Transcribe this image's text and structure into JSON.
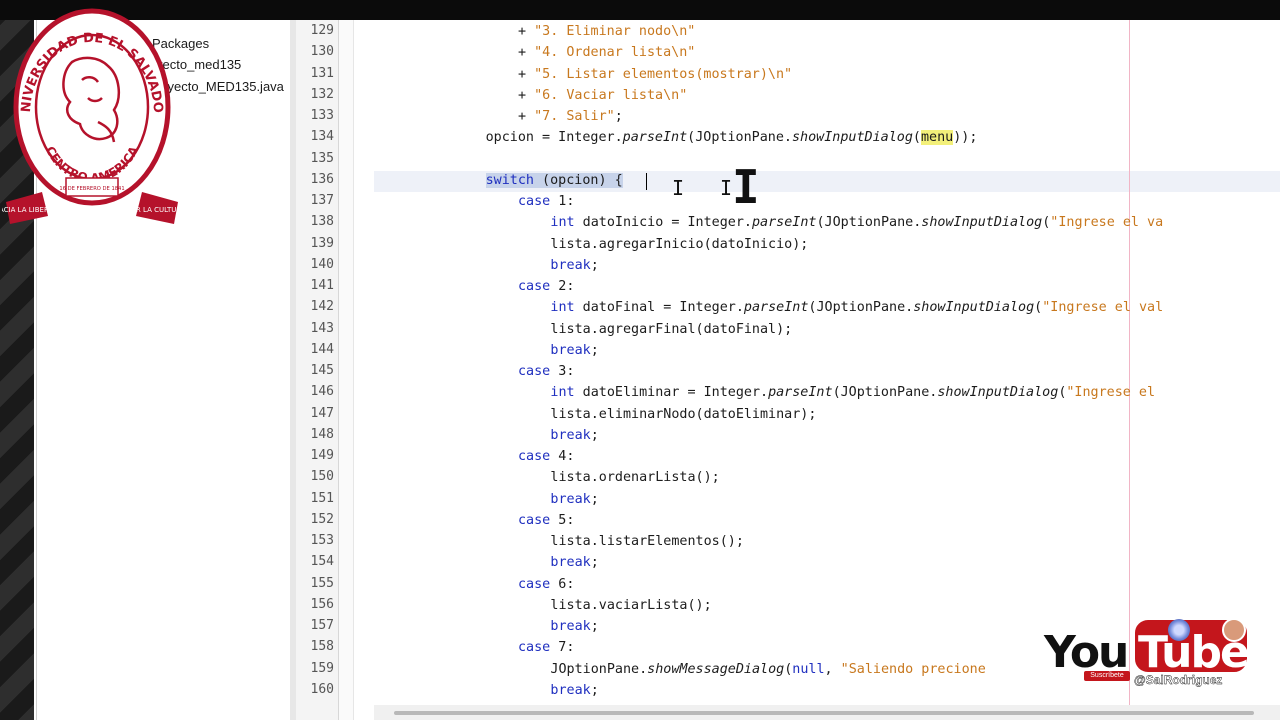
{
  "project_tree": {
    "items": [
      "Packages",
      "yecto_med135",
      "royecto_MED135.java"
    ]
  },
  "editor": {
    "lines": [
      {
        "n": "129",
        "indent": 20,
        "tokens": [
          {
            "t": "+ "
          },
          {
            "t": "\"3. Eliminar nodo\\n\"",
            "c": "str"
          }
        ]
      },
      {
        "n": "130",
        "indent": 20,
        "tokens": [
          {
            "t": "+ "
          },
          {
            "t": "\"4. Ordenar lista\\n\"",
            "c": "str"
          }
        ]
      },
      {
        "n": "131",
        "indent": 20,
        "tokens": [
          {
            "t": "+ "
          },
          {
            "t": "\"5. Listar elementos(mostrar)\\n\"",
            "c": "str"
          }
        ]
      },
      {
        "n": "132",
        "indent": 20,
        "tokens": [
          {
            "t": "+ "
          },
          {
            "t": "\"6. Vaciar lista\\n\"",
            "c": "str"
          }
        ]
      },
      {
        "n": "133",
        "indent": 20,
        "tokens": [
          {
            "t": "+ "
          },
          {
            "t": "\"7. Salir\"",
            "c": "str"
          },
          {
            "t": ";"
          }
        ]
      },
      {
        "n": "134",
        "indent": 16,
        "tokens": [
          {
            "t": "opcion = Integer."
          },
          {
            "t": "parseInt",
            "c": "it"
          },
          {
            "t": "(JOptionPane."
          },
          {
            "t": "showInputDialog",
            "c": "it"
          },
          {
            "t": "("
          },
          {
            "t": "menu",
            "c": "hl-word"
          },
          {
            "t": "));"
          }
        ]
      },
      {
        "n": "135",
        "indent": 0,
        "tokens": []
      },
      {
        "n": "136",
        "indent": 16,
        "tokens": [
          {
            "t": "switch",
            "c": "kw sel"
          },
          {
            "t": " (opcion) {",
            "c": "sel"
          }
        ]
      },
      {
        "n": "137",
        "indent": 20,
        "tokens": [
          {
            "t": "case",
            "c": "kw"
          },
          {
            "t": " 1:"
          }
        ]
      },
      {
        "n": "138",
        "indent": 24,
        "tokens": [
          {
            "t": "int",
            "c": "kw"
          },
          {
            "t": " datoInicio = Integer."
          },
          {
            "t": "parseInt",
            "c": "it"
          },
          {
            "t": "(JOptionPane."
          },
          {
            "t": "showInputDialog",
            "c": "it"
          },
          {
            "t": "("
          },
          {
            "t": "\"Ingrese el va",
            "c": "str"
          }
        ]
      },
      {
        "n": "139",
        "indent": 24,
        "tokens": [
          {
            "t": "lista.agregarInicio(datoInicio);"
          }
        ]
      },
      {
        "n": "140",
        "indent": 24,
        "tokens": [
          {
            "t": "break",
            "c": "kw"
          },
          {
            "t": ";"
          }
        ]
      },
      {
        "n": "141",
        "indent": 20,
        "tokens": [
          {
            "t": "case",
            "c": "kw"
          },
          {
            "t": " 2:"
          }
        ]
      },
      {
        "n": "142",
        "indent": 24,
        "tokens": [
          {
            "t": "int",
            "c": "kw"
          },
          {
            "t": " datoFinal = Integer."
          },
          {
            "t": "parseInt",
            "c": "it"
          },
          {
            "t": "(JOptionPane."
          },
          {
            "t": "showInputDialog",
            "c": "it"
          },
          {
            "t": "("
          },
          {
            "t": "\"Ingrese el val",
            "c": "str"
          }
        ]
      },
      {
        "n": "143",
        "indent": 24,
        "tokens": [
          {
            "t": "lista.agregarFinal(datoFinal);"
          }
        ]
      },
      {
        "n": "144",
        "indent": 24,
        "tokens": [
          {
            "t": "break",
            "c": "kw"
          },
          {
            "t": ";"
          }
        ]
      },
      {
        "n": "145",
        "indent": 20,
        "tokens": [
          {
            "t": "case",
            "c": "kw"
          },
          {
            "t": " 3:"
          }
        ]
      },
      {
        "n": "146",
        "indent": 24,
        "tokens": [
          {
            "t": "int",
            "c": "kw"
          },
          {
            "t": " datoEliminar = Integer."
          },
          {
            "t": "parseInt",
            "c": "it"
          },
          {
            "t": "(JOptionPane."
          },
          {
            "t": "showInputDialog",
            "c": "it"
          },
          {
            "t": "("
          },
          {
            "t": "\"Ingrese el",
            "c": "str"
          }
        ]
      },
      {
        "n": "147",
        "indent": 24,
        "tokens": [
          {
            "t": "lista.eliminarNodo(datoEliminar);"
          }
        ]
      },
      {
        "n": "148",
        "indent": 24,
        "tokens": [
          {
            "t": "break",
            "c": "kw"
          },
          {
            "t": ";"
          }
        ]
      },
      {
        "n": "149",
        "indent": 20,
        "tokens": [
          {
            "t": "case",
            "c": "kw"
          },
          {
            "t": " 4:"
          }
        ]
      },
      {
        "n": "150",
        "indent": 24,
        "tokens": [
          {
            "t": "lista.ordenarLista();"
          }
        ]
      },
      {
        "n": "151",
        "indent": 24,
        "tokens": [
          {
            "t": "break",
            "c": "kw"
          },
          {
            "t": ";"
          }
        ]
      },
      {
        "n": "152",
        "indent": 20,
        "tokens": [
          {
            "t": "case",
            "c": "kw"
          },
          {
            "t": " 5:"
          }
        ]
      },
      {
        "n": "153",
        "indent": 24,
        "tokens": [
          {
            "t": "lista.listarElementos();"
          }
        ]
      },
      {
        "n": "154",
        "indent": 24,
        "tokens": [
          {
            "t": "break",
            "c": "kw"
          },
          {
            "t": ";"
          }
        ]
      },
      {
        "n": "155",
        "indent": 20,
        "tokens": [
          {
            "t": "case",
            "c": "kw"
          },
          {
            "t": " 6:"
          }
        ]
      },
      {
        "n": "156",
        "indent": 24,
        "tokens": [
          {
            "t": "lista.vaciarLista();"
          }
        ]
      },
      {
        "n": "157",
        "indent": 24,
        "tokens": [
          {
            "t": "break",
            "c": "kw"
          },
          {
            "t": ";"
          }
        ]
      },
      {
        "n": "158",
        "indent": 20,
        "tokens": [
          {
            "t": "case",
            "c": "kw"
          },
          {
            "t": " 7:"
          }
        ]
      },
      {
        "n": "159",
        "indent": 24,
        "tokens": [
          {
            "t": "JOptionPane."
          },
          {
            "t": "showMessageDialog",
            "c": "it"
          },
          {
            "t": "("
          },
          {
            "t": "null",
            "c": "kw"
          },
          {
            "t": ", "
          },
          {
            "t": "\"Saliendo precione",
            "c": "str"
          }
        ]
      },
      {
        "n": "160",
        "indent": 24,
        "tokens": [
          {
            "t": "break",
            "c": "kw"
          },
          {
            "t": ";"
          }
        ]
      }
    ]
  },
  "overlay": {
    "seal": {
      "name": "UNIVERSIDAD DE EL SALVADOR",
      "region": "CENTRO AMERICA",
      "date": "16 DE FEBRERO DE 1841",
      "left_motto": "HACIA LA LIBERTAD",
      "right_motto": "POR LA CULTURA",
      "color": "#b5122b"
    },
    "youtube": {
      "you": "You",
      "tube": "Tube",
      "handle": "@SalRodriguez",
      "subscribe": "Suscríbete",
      "color": "#c4161c"
    }
  },
  "colors": {
    "keyword": "#1f2fbf",
    "string": "#c8781e",
    "selection": "#c7d3ea",
    "highlight": "#f3f07a"
  }
}
